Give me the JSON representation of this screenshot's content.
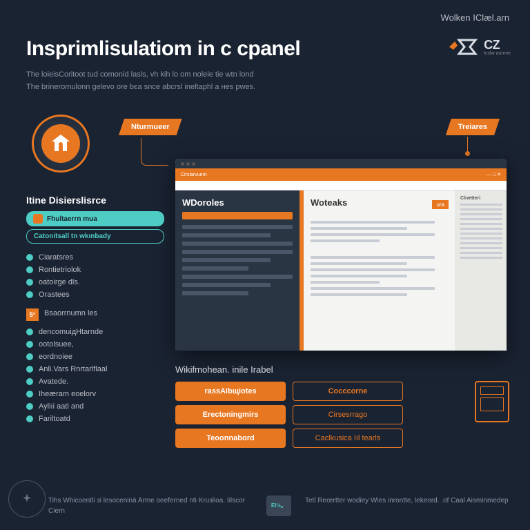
{
  "top_right": "Wolken IClæl.aɾn",
  "brand": {
    "text": "CZ",
    "sub": "tcslw aunme"
  },
  "title": "Insprimlisulatiom in c cpanel",
  "subtitle_line1": "The loieisCoritoot tud comonid lasls, vh kih lo om nolele tie wtn lond",
  "subtitle_line2": "The brineromulonn gelevo ore bєa snce abcrsl ineltaphl a ʜes pwes.",
  "tags": {
    "left": "Nturmueer",
    "right": "Treiares"
  },
  "sidebar": {
    "header": "Itine Disierslisrce",
    "pills": [
      "Fhultaerrn mua",
      "Catonitsall tn wkınbady"
    ],
    "list1": [
      "Ciaratsres",
      "Rontietriolok",
      "oatoirge dls.",
      "Orastees"
    ],
    "num_label": "Bsaorrnumn les",
    "list2": [
      "dencomuiдHtarnde",
      "ootolsuee,",
      "eordnoiee",
      "Anli.Vars Rnrtarlflaal",
      "Avatede.",
      "Iheæram eoelorv",
      "Ayliıi aati and",
      "Fariltoatd"
    ]
  },
  "browser": {
    "bar_left": "Cirslarvuern",
    "left_title": "WDoroles",
    "right_title": "Woteaks",
    "right_tag": "ura",
    "sidebar_h": "Clrætteri"
  },
  "bottom": {
    "title": "Wikifmohean. inile Irabel",
    "buttons_left": [
      "rassAibщiotes",
      "Erectoningmirs",
      "Teoonnabord"
    ],
    "buttons_right": [
      "Cocccorne",
      "Cirsesrrago",
      "Caclkusica Iıl tearls"
    ]
  },
  "footer": {
    "left": "Tihs Whicoentli зi lesoceninä Arme oeeferned nti Kruзlioa. Iilscor Ciern",
    "badge": "EI½。",
    "right": "Tetl Reœrtter wodiey Wies inrontte, lekeord. .of Caal Aisminmedep"
  }
}
